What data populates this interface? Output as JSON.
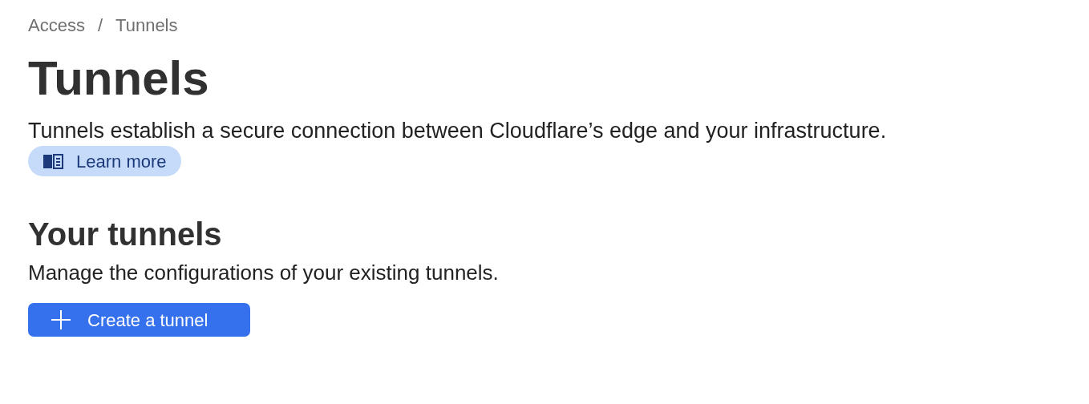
{
  "breadcrumb": [
    {
      "label": "Access"
    },
    {
      "label": "Tunnels"
    }
  ],
  "breadcrumb_separator": "/",
  "title": "Tunnels",
  "description": "Tunnels establish a secure connection between Cloudflare’s edge and your infrastructure.",
  "learn_more": {
    "label": "Learn more"
  },
  "section": {
    "title": "Your tunnels",
    "description": "Manage the configurations of your existing tunnels.",
    "button": {
      "label": "Create a tunnel"
    }
  }
}
